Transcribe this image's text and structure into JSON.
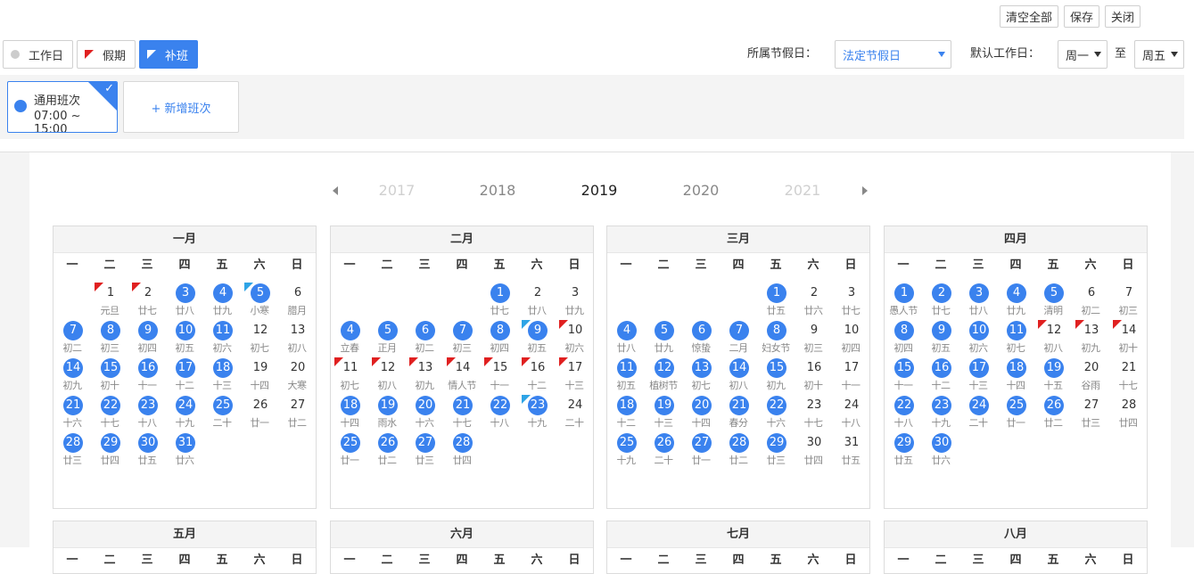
{
  "toolbar": {
    "clear_all": "清空全部",
    "save": "保存",
    "close": "关闭"
  },
  "types": {
    "workday": "工作日",
    "holiday": "假期",
    "makeup": "补班"
  },
  "filters": {
    "holiday_label": "所属节假日：",
    "holiday_value": "法定节假日",
    "workday_label": "默认工作日：",
    "from_value": "周一",
    "to_label": "至",
    "to_value": "周五"
  },
  "shift": {
    "name": "通用班次",
    "time": "07:00 ~ 15:00",
    "add_label": "+ 新增班次"
  },
  "years": [
    "2017",
    "2018",
    "2019",
    "2020",
    "2021"
  ],
  "current_year": "2019",
  "weekdays": [
    "一",
    "二",
    "三",
    "四",
    "五",
    "六",
    "日"
  ],
  "colors": {
    "accent": "#3a82ee",
    "holiday_flag": "#e02020",
    "makeup_flag": "#2ea4e6"
  },
  "months": [
    {
      "title": "一月",
      "first_weekday": 1,
      "days": [
        {
          "d": 1,
          "l": "元旦",
          "s": "h"
        },
        {
          "d": 2,
          "l": "廿七",
          "s": "h"
        },
        {
          "d": 3,
          "l": "廿八",
          "s": "w"
        },
        {
          "d": 4,
          "l": "廿九",
          "s": "w"
        },
        {
          "d": 5,
          "l": "小寒",
          "s": "m"
        },
        {
          "d": 6,
          "l": "腊月",
          "s": ""
        },
        {
          "d": 7,
          "l": "初二",
          "s": "w"
        },
        {
          "d": 8,
          "l": "初三",
          "s": "w"
        },
        {
          "d": 9,
          "l": "初四",
          "s": "w"
        },
        {
          "d": 10,
          "l": "初五",
          "s": "w"
        },
        {
          "d": 11,
          "l": "初六",
          "s": "w"
        },
        {
          "d": 12,
          "l": "初七",
          "s": ""
        },
        {
          "d": 13,
          "l": "初八",
          "s": ""
        },
        {
          "d": 14,
          "l": "初九",
          "s": "w"
        },
        {
          "d": 15,
          "l": "初十",
          "s": "w"
        },
        {
          "d": 16,
          "l": "十一",
          "s": "w"
        },
        {
          "d": 17,
          "l": "十二",
          "s": "w"
        },
        {
          "d": 18,
          "l": "十三",
          "s": "w"
        },
        {
          "d": 19,
          "l": "十四",
          "s": ""
        },
        {
          "d": 20,
          "l": "大寒",
          "s": ""
        },
        {
          "d": 21,
          "l": "十六",
          "s": "w"
        },
        {
          "d": 22,
          "l": "十七",
          "s": "w"
        },
        {
          "d": 23,
          "l": "十八",
          "s": "w"
        },
        {
          "d": 24,
          "l": "十九",
          "s": "w"
        },
        {
          "d": 25,
          "l": "二十",
          "s": "w"
        },
        {
          "d": 26,
          "l": "廿一",
          "s": ""
        },
        {
          "d": 27,
          "l": "廿二",
          "s": ""
        },
        {
          "d": 28,
          "l": "廿三",
          "s": "w"
        },
        {
          "d": 29,
          "l": "廿四",
          "s": "w"
        },
        {
          "d": 30,
          "l": "廿五",
          "s": "w"
        },
        {
          "d": 31,
          "l": "廿六",
          "s": "w"
        }
      ]
    },
    {
      "title": "二月",
      "first_weekday": 4,
      "days": [
        {
          "d": 1,
          "l": "廿七",
          "s": "w"
        },
        {
          "d": 2,
          "l": "廿八",
          "s": ""
        },
        {
          "d": 3,
          "l": "廿九",
          "s": ""
        },
        {
          "d": 4,
          "l": "立春",
          "s": "w"
        },
        {
          "d": 5,
          "l": "正月",
          "s": "w"
        },
        {
          "d": 6,
          "l": "初二",
          "s": "w"
        },
        {
          "d": 7,
          "l": "初三",
          "s": "w"
        },
        {
          "d": 8,
          "l": "初四",
          "s": "w"
        },
        {
          "d": 9,
          "l": "初五",
          "s": "m"
        },
        {
          "d": 10,
          "l": "初六",
          "s": "h"
        },
        {
          "d": 11,
          "l": "初七",
          "s": "h"
        },
        {
          "d": 12,
          "l": "初八",
          "s": "h"
        },
        {
          "d": 13,
          "l": "初九",
          "s": "h"
        },
        {
          "d": 14,
          "l": "情人节",
          "s": "h"
        },
        {
          "d": 15,
          "l": "十一",
          "s": "h"
        },
        {
          "d": 16,
          "l": "十二",
          "s": "h"
        },
        {
          "d": 17,
          "l": "十三",
          "s": "h"
        },
        {
          "d": 18,
          "l": "十四",
          "s": "w"
        },
        {
          "d": 19,
          "l": "雨水",
          "s": "w"
        },
        {
          "d": 20,
          "l": "十六",
          "s": "w"
        },
        {
          "d": 21,
          "l": "十七",
          "s": "w"
        },
        {
          "d": 22,
          "l": "十八",
          "s": "w"
        },
        {
          "d": 23,
          "l": "十九",
          "s": "m"
        },
        {
          "d": 24,
          "l": "二十",
          "s": ""
        },
        {
          "d": 25,
          "l": "廿一",
          "s": "w"
        },
        {
          "d": 26,
          "l": "廿二",
          "s": "w"
        },
        {
          "d": 27,
          "l": "廿三",
          "s": "w"
        },
        {
          "d": 28,
          "l": "廿四",
          "s": "w"
        }
      ]
    },
    {
      "title": "三月",
      "first_weekday": 4,
      "days": [
        {
          "d": 1,
          "l": "廿五",
          "s": "w"
        },
        {
          "d": 2,
          "l": "廿六",
          "s": ""
        },
        {
          "d": 3,
          "l": "廿七",
          "s": ""
        },
        {
          "d": 4,
          "l": "廿八",
          "s": "w"
        },
        {
          "d": 5,
          "l": "廿九",
          "s": "w"
        },
        {
          "d": 6,
          "l": "惊蛰",
          "s": "w"
        },
        {
          "d": 7,
          "l": "二月",
          "s": "w"
        },
        {
          "d": 8,
          "l": "妇女节",
          "s": "w"
        },
        {
          "d": 9,
          "l": "初三",
          "s": ""
        },
        {
          "d": 10,
          "l": "初四",
          "s": ""
        },
        {
          "d": 11,
          "l": "初五",
          "s": "w"
        },
        {
          "d": 12,
          "l": "植树节",
          "s": "w"
        },
        {
          "d": 13,
          "l": "初七",
          "s": "w"
        },
        {
          "d": 14,
          "l": "初八",
          "s": "w"
        },
        {
          "d": 15,
          "l": "初九",
          "s": "w"
        },
        {
          "d": 16,
          "l": "初十",
          "s": ""
        },
        {
          "d": 17,
          "l": "十一",
          "s": ""
        },
        {
          "d": 18,
          "l": "十二",
          "s": "w"
        },
        {
          "d": 19,
          "l": "十三",
          "s": "w"
        },
        {
          "d": 20,
          "l": "十四",
          "s": "w"
        },
        {
          "d": 21,
          "l": "春分",
          "s": "w"
        },
        {
          "d": 22,
          "l": "十六",
          "s": "w"
        },
        {
          "d": 23,
          "l": "十七",
          "s": ""
        },
        {
          "d": 24,
          "l": "十八",
          "s": ""
        },
        {
          "d": 25,
          "l": "十九",
          "s": "w"
        },
        {
          "d": 26,
          "l": "二十",
          "s": "w"
        },
        {
          "d": 27,
          "l": "廿一",
          "s": "w"
        },
        {
          "d": 28,
          "l": "廿二",
          "s": "w"
        },
        {
          "d": 29,
          "l": "廿三",
          "s": "w"
        },
        {
          "d": 30,
          "l": "廿四",
          "s": ""
        },
        {
          "d": 31,
          "l": "廿五",
          "s": ""
        }
      ]
    },
    {
      "title": "四月",
      "first_weekday": 0,
      "days": [
        {
          "d": 1,
          "l": "愚人节",
          "s": "w"
        },
        {
          "d": 2,
          "l": "廿七",
          "s": "w"
        },
        {
          "d": 3,
          "l": "廿八",
          "s": "w"
        },
        {
          "d": 4,
          "l": "廿九",
          "s": "w"
        },
        {
          "d": 5,
          "l": "清明",
          "s": "w"
        },
        {
          "d": 6,
          "l": "初二",
          "s": ""
        },
        {
          "d": 7,
          "l": "初三",
          "s": ""
        },
        {
          "d": 8,
          "l": "初四",
          "s": "w"
        },
        {
          "d": 9,
          "l": "初五",
          "s": "w"
        },
        {
          "d": 10,
          "l": "初六",
          "s": "w"
        },
        {
          "d": 11,
          "l": "初七",
          "s": "w"
        },
        {
          "d": 12,
          "l": "初八",
          "s": "h"
        },
        {
          "d": 13,
          "l": "初九",
          "s": "h"
        },
        {
          "d": 14,
          "l": "初十",
          "s": "h"
        },
        {
          "d": 15,
          "l": "十一",
          "s": "w"
        },
        {
          "d": 16,
          "l": "十二",
          "s": "w"
        },
        {
          "d": 17,
          "l": "十三",
          "s": "w"
        },
        {
          "d": 18,
          "l": "十四",
          "s": "w"
        },
        {
          "d": 19,
          "l": "十五",
          "s": "w"
        },
        {
          "d": 20,
          "l": "谷雨",
          "s": ""
        },
        {
          "d": 21,
          "l": "十七",
          "s": ""
        },
        {
          "d": 22,
          "l": "十八",
          "s": "w"
        },
        {
          "d": 23,
          "l": "十九",
          "s": "w"
        },
        {
          "d": 24,
          "l": "二十",
          "s": "w"
        },
        {
          "d": 25,
          "l": "廿一",
          "s": "w"
        },
        {
          "d": 26,
          "l": "廿二",
          "s": "w"
        },
        {
          "d": 27,
          "l": "廿三",
          "s": ""
        },
        {
          "d": 28,
          "l": "廿四",
          "s": ""
        },
        {
          "d": 29,
          "l": "廿五",
          "s": "w"
        },
        {
          "d": 30,
          "l": "廿六",
          "s": "w"
        }
      ]
    },
    {
      "title": "五月",
      "first_weekday": 2,
      "days": []
    },
    {
      "title": "六月",
      "first_weekday": 5,
      "days": []
    },
    {
      "title": "七月",
      "first_weekday": 0,
      "days": []
    },
    {
      "title": "八月",
      "first_weekday": 3,
      "days": []
    }
  ]
}
